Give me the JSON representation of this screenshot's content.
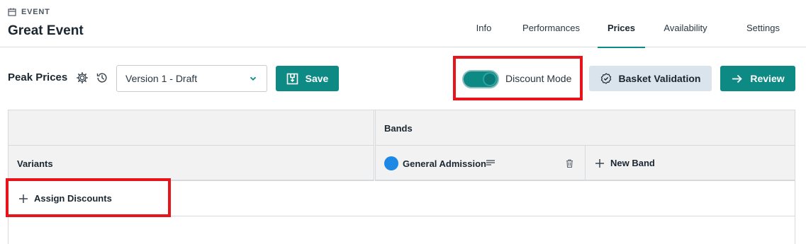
{
  "header": {
    "eyebrow": "EVENT",
    "title": "Great Event",
    "tabs": [
      {
        "label": "Info",
        "active": false
      },
      {
        "label": "Performances",
        "active": false
      },
      {
        "label": "Prices",
        "active": true
      },
      {
        "label": "Availability",
        "active": false
      },
      {
        "label": "Settings",
        "active": false
      }
    ]
  },
  "toolbar": {
    "title": "Peak Prices",
    "version_select": "Version 1 - Draft",
    "save_label": "Save",
    "discount_mode_label": "Discount Mode",
    "discount_mode_on": true,
    "basket_validation_label": "Basket Validation",
    "review_label": "Review"
  },
  "grid": {
    "bands_header": "Bands",
    "variants_header": "Variants",
    "bands": [
      {
        "name": "General Admission",
        "color": "#1e88e5"
      }
    ],
    "new_band_label": "New Band",
    "assign_discounts_label": "Assign Discounts"
  },
  "colors": {
    "accent": "#0e8a85",
    "highlight": "#e8141b",
    "secondary_button": "#d9e4ec"
  }
}
